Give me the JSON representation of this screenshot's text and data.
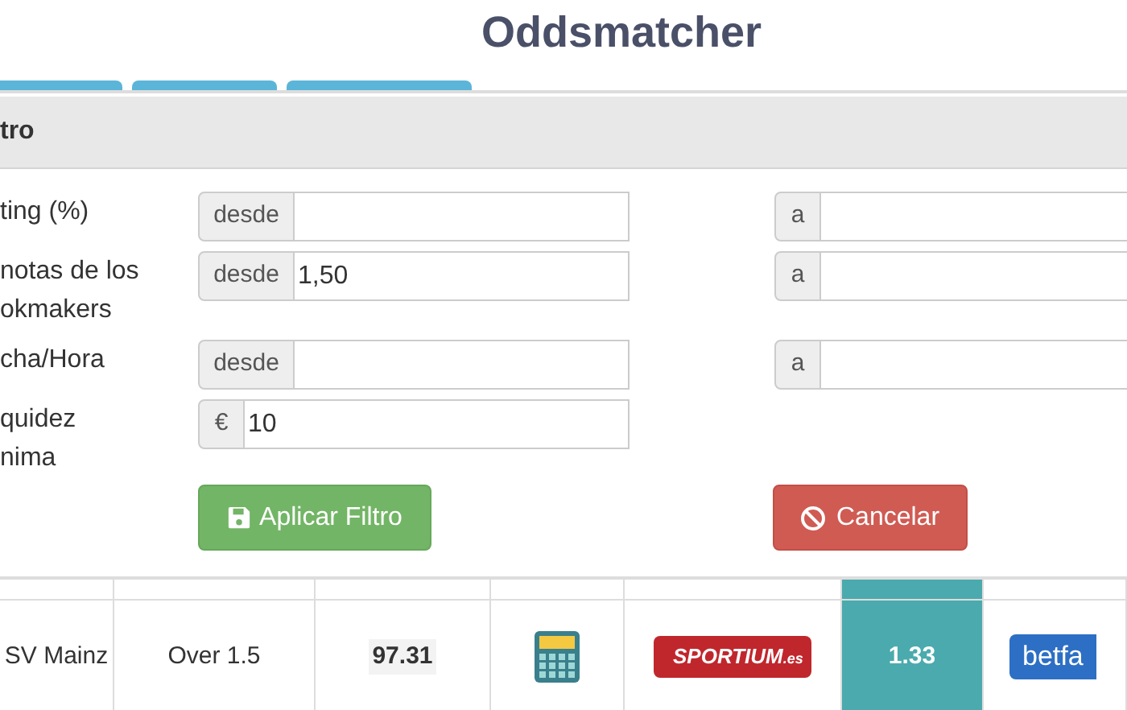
{
  "title": "Oddsmatcher",
  "tabs": [
    {
      "selected": false
    },
    {
      "selected": false
    },
    {
      "selected": false
    }
  ],
  "filter_panel": {
    "heading": "tro",
    "rows": [
      {
        "label": "ting (%)",
        "from": {
          "addon": "desde"
        },
        "to": {
          "addon": "a"
        }
      },
      {
        "label": "notas de los\nokmakers",
        "from": {
          "addon": "desde",
          "value": "1,50"
        },
        "to": {
          "addon": "a"
        }
      },
      {
        "label": "cha/Hora",
        "from": {
          "addon": "desde"
        },
        "to": {
          "addon": "a"
        }
      },
      {
        "label": "quidez\nnima",
        "from": {
          "addon": "€",
          "value": "10"
        }
      }
    ],
    "buttons": [
      {
        "label": "Aplicar Filtro",
        "kind": "apply"
      },
      {
        "label": "Cancelar",
        "kind": "cancel"
      }
    ]
  },
  "table": {
    "rows": [
      [
        {
          "kind": "text",
          "text": "SV Mainz"
        },
        {
          "kind": "text",
          "text": "Over 1.5"
        },
        {
          "kind": "rating",
          "text": "97.31"
        },
        {
          "kind": "calculator"
        },
        {
          "kind": "sportium",
          "text": "SPORTIUM",
          "suffix": ".es"
        },
        {
          "kind": "odds",
          "text": "1.33"
        },
        {
          "kind": "betfair",
          "text": "betfa"
        }
      ]
    ]
  }
}
